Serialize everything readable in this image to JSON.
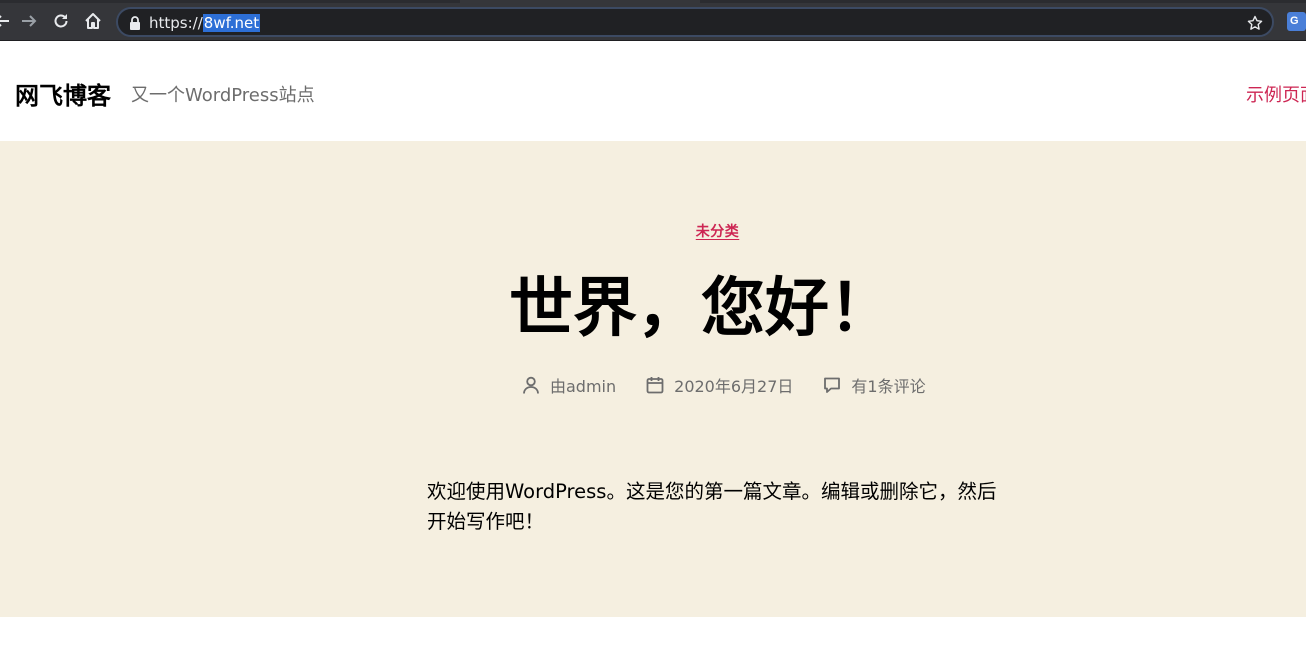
{
  "browser": {
    "url_scheme": "https://",
    "url_host": "8wf.net",
    "extension_label": "G",
    "icons": {
      "back": "back-arrow-icon",
      "forward": "forward-arrow-icon",
      "reload": "reload-icon",
      "home": "home-icon",
      "lock": "lock-icon",
      "bookmark": "star-icon"
    }
  },
  "site": {
    "title": "网飞博客",
    "description": "又一个WordPress站点",
    "menu_item": "示例页面",
    "accent_color": "#cd2653",
    "hero_background": "#f5efe0"
  },
  "post": {
    "category": "未分类",
    "title": "世界，您好！",
    "author": "由admin",
    "date": "2020年6月27日",
    "comments": "有1条评论",
    "content": "欢迎使用WordPress。这是您的第一篇文章。编辑或删除它，然后开始写作吧！"
  }
}
